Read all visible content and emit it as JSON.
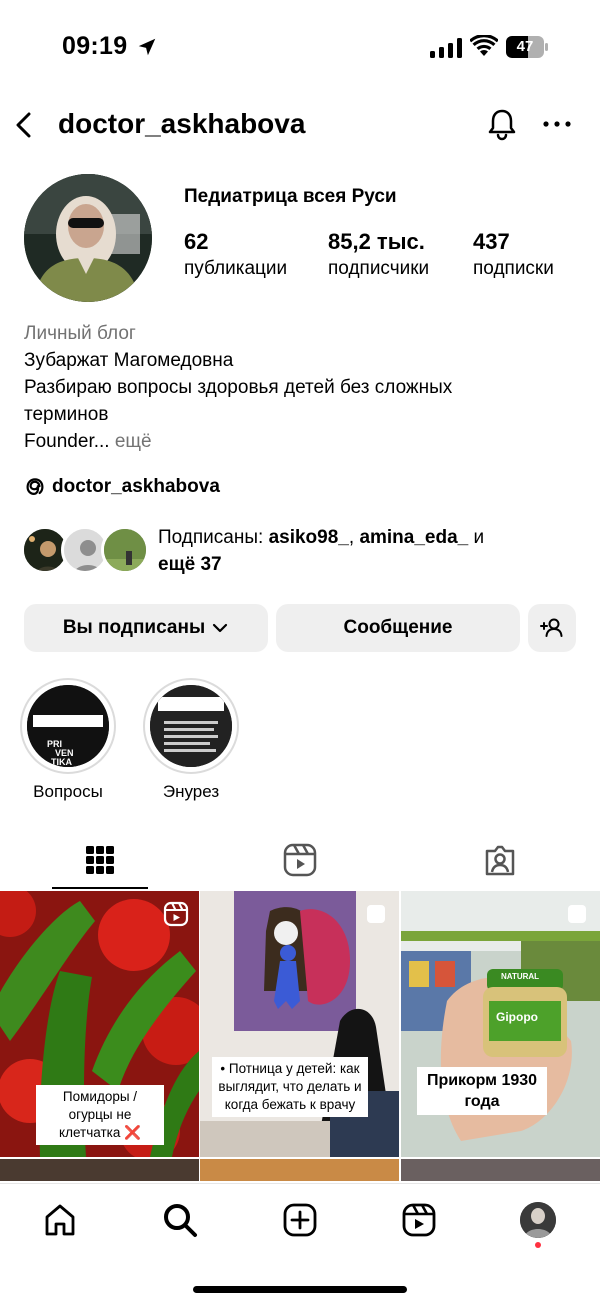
{
  "status_bar": {
    "time": "09:19",
    "battery": "47"
  },
  "header": {
    "username": "doctor_askhabova"
  },
  "profile": {
    "display_name": "Педиатрица всея Руси",
    "stats": [
      {
        "value": "62",
        "label": "публикации"
      },
      {
        "value": "85,2 тыс.",
        "label": "подписчики"
      },
      {
        "value": "437",
        "label": "подписки"
      }
    ],
    "bio": {
      "category": "Личный блог",
      "line1": "Зубаржат Магомедовна",
      "line2": "Разбираю вопросы здоровья детей  без сложных",
      "line3": "терминов",
      "line4": "Founder...",
      "more": "ещё"
    },
    "threads_handle": "doctor_askhabova",
    "followed_by": {
      "prefix": "Подписаны: ",
      "user1": "asiko98_",
      "sep": ", ",
      "user2": "amina_eda_",
      "and": " и",
      "others": "ещё 37"
    }
  },
  "buttons": {
    "following": "Вы подписаны",
    "message": "Сообщение"
  },
  "highlights": [
    {
      "label": "Вопросы"
    },
    {
      "label": "Энурез"
    }
  ],
  "posts": [
    {
      "caption": "Помидоры / огурцы не клетчатка ❌",
      "type": "reel"
    },
    {
      "caption": "• Потница у детей: как выглядит, что делать и когда бежать к врачу",
      "type": "carousel"
    },
    {
      "caption": "Прикорм 1930 года",
      "type": "carousel"
    }
  ],
  "colors": {
    "notification_dot": "#ff3040",
    "button_bg": "#efefef",
    "muted_text": "#737373"
  }
}
